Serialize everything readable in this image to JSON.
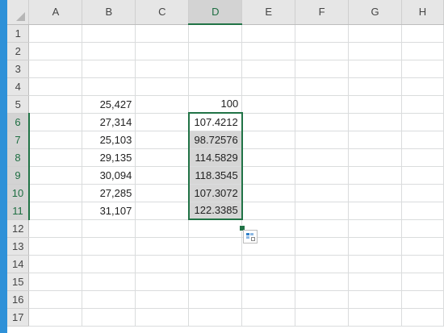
{
  "columns": [
    "A",
    "B",
    "C",
    "D",
    "E",
    "F",
    "G",
    "H"
  ],
  "selected_column": "D",
  "rows": [
    {
      "num": "1",
      "B": "",
      "D": ""
    },
    {
      "num": "2",
      "B": "",
      "D": ""
    },
    {
      "num": "3",
      "B": "",
      "D": ""
    },
    {
      "num": "4",
      "B": "",
      "D": ""
    },
    {
      "num": "5",
      "B": "25,427",
      "D": "100"
    },
    {
      "num": "6",
      "B": "27,314",
      "D": "107.4212"
    },
    {
      "num": "7",
      "B": "25,103",
      "D": "98.72576"
    },
    {
      "num": "8",
      "B": "29,135",
      "D": "114.5829"
    },
    {
      "num": "9",
      "B": "30,094",
      "D": "118.3545"
    },
    {
      "num": "10",
      "B": "27,285",
      "D": "107.3072"
    },
    {
      "num": "11",
      "B": "31,107",
      "D": "122.3385"
    },
    {
      "num": "12",
      "B": "",
      "D": ""
    },
    {
      "num": "13",
      "B": "",
      "D": ""
    },
    {
      "num": "14",
      "B": "",
      "D": ""
    },
    {
      "num": "15",
      "B": "",
      "D": ""
    },
    {
      "num": "16",
      "B": "",
      "D": ""
    },
    {
      "num": "17",
      "B": "",
      "D": ""
    }
  ],
  "selection": {
    "column": "D",
    "from_row": 6,
    "to_row": 11,
    "active_row": 6
  },
  "colors": {
    "selection_border": "#217346",
    "selection_fill": "#d6d6d6",
    "header_bg": "#e6e6e6",
    "window_accent": "#2e91d8"
  },
  "icons": {
    "quick_analysis": "quick-analysis-icon",
    "select_all": "select-all-icon"
  }
}
